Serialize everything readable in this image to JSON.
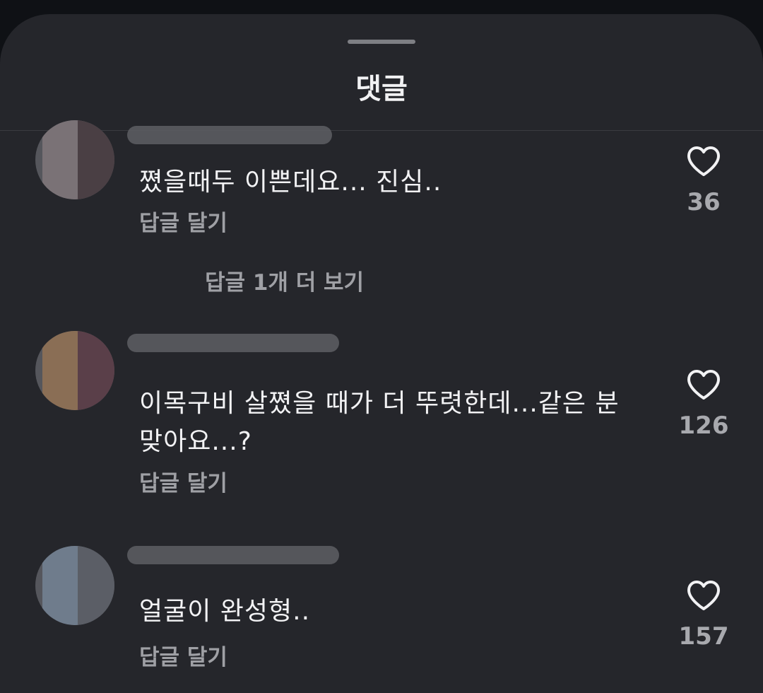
{
  "sheet": {
    "title": "댓글"
  },
  "comments": [
    {
      "text": "쪘을때두 이쁜데요... 진심..",
      "reply_label": "답글 달기",
      "likes": "36",
      "more_replies": "답글 1개 더 보기"
    },
    {
      "text": "이목구비 살쪘을 때가 더 뚜렷한데...같은 분 맞아요...?",
      "reply_label": "답글 달기",
      "likes": "126"
    },
    {
      "text": "얼굴이 완성형..",
      "reply_label": "답글 달기",
      "likes": "157"
    }
  ],
  "icons": {
    "like": "heart-outline-icon"
  },
  "colors": {
    "background": "#25262b",
    "text": "#f2f2f4",
    "secondary_text": "#9fa0a5"
  }
}
